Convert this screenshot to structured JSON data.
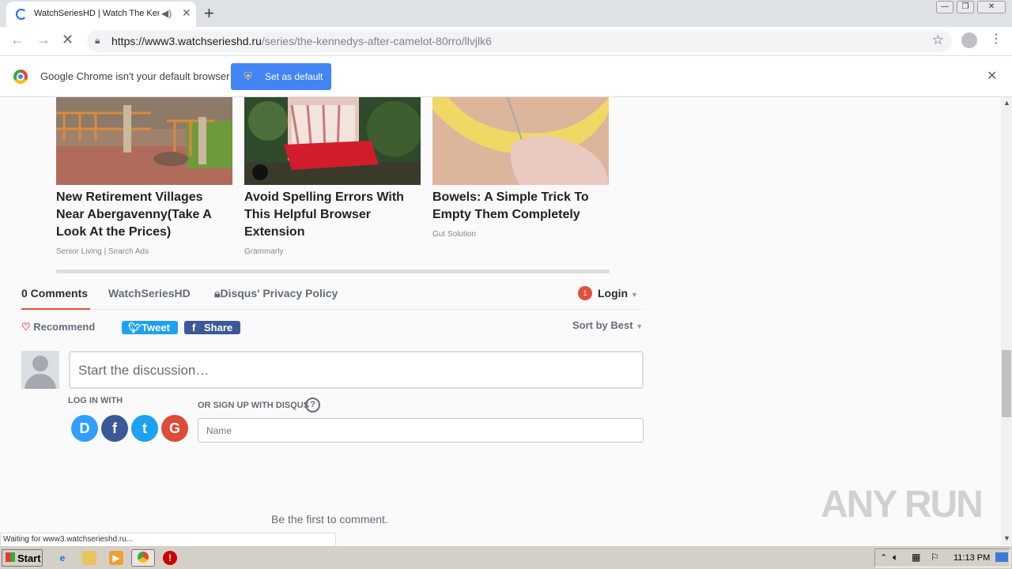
{
  "browser": {
    "tab": {
      "title": "WatchSeriesHD | Watch The Kennedys After Camelot",
      "audio_icon": "speaker-icon",
      "close_glyph": "✕"
    },
    "new_tab_glyph": "+",
    "window_controls": [
      "minimize",
      "restore",
      "close"
    ],
    "url": {
      "host": "https://www3.watchserieshd.ru",
      "path": "/series/the-kennedys-after-camelot-80rro/llvjlk6"
    },
    "infobar": {
      "message": "Google Chrome isn't your default browser",
      "button": "Set as default"
    },
    "status": "Waiting for www3.watchserieshd.ru..."
  },
  "ads": [
    {
      "title": "New Retirement Villages Near Abergavenny(Take A Look At the Prices)",
      "source": "Senior Living | Search Ads"
    },
    {
      "title": "Avoid Spelling Errors With This Helpful Browser Extension",
      "source": "Grammarly"
    },
    {
      "title": "Bowels: A Simple Trick To Empty Them Completely",
      "source": "Gut Solution"
    }
  ],
  "disqus": {
    "tabs": {
      "comments": "0 Comments",
      "site": "WatchSeriesHD",
      "privacy": "Disqus' Privacy Policy"
    },
    "login": "Login",
    "notification_count": "1",
    "recommend": "Recommend",
    "tweet": "Tweet",
    "share": "Share",
    "sort": "Sort by Best",
    "discussion_placeholder": "Start the discussion…",
    "log_in_with": "LOG IN WITH",
    "sign_up": "OR SIGN UP WITH DISQUS",
    "help_glyph": "?",
    "sso": [
      "D",
      "f",
      "t",
      "G"
    ],
    "name_placeholder": "Name",
    "empty": "Be the first to comment."
  },
  "watermark": "ANY RUN",
  "taskbar": {
    "start": "Start",
    "clock": "11:13 PM"
  },
  "colors": {
    "accent": "#4285f4",
    "disqus_red": "#e1503c",
    "twitter": "#1da1f2",
    "facebook": "#3b5998",
    "google": "#dd4b39",
    "disqus_blue": "#2e9fff"
  }
}
